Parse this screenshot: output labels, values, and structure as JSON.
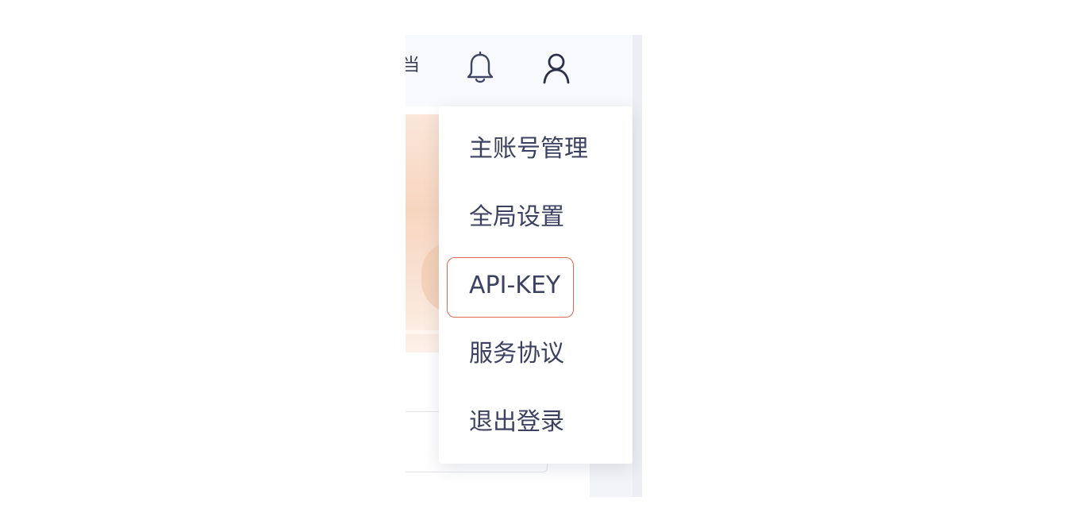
{
  "topbar": {
    "fragment_text": "当",
    "icons": {
      "bell": "bell-icon",
      "user": "user-icon"
    }
  },
  "dropdown": {
    "items": [
      {
        "label": "主账号管理"
      },
      {
        "label": "全局设置"
      },
      {
        "label": "API-KEY"
      },
      {
        "label": "服务协议"
      },
      {
        "label": "退出登录"
      }
    ],
    "highlighted_item": "API-KEY"
  },
  "colors": {
    "text": "#3d4161",
    "icon": "#3f4462",
    "highlight_border": "#e06a4e",
    "topbar_bg": "#f8f9fc",
    "banner": "#f7d6c0"
  }
}
